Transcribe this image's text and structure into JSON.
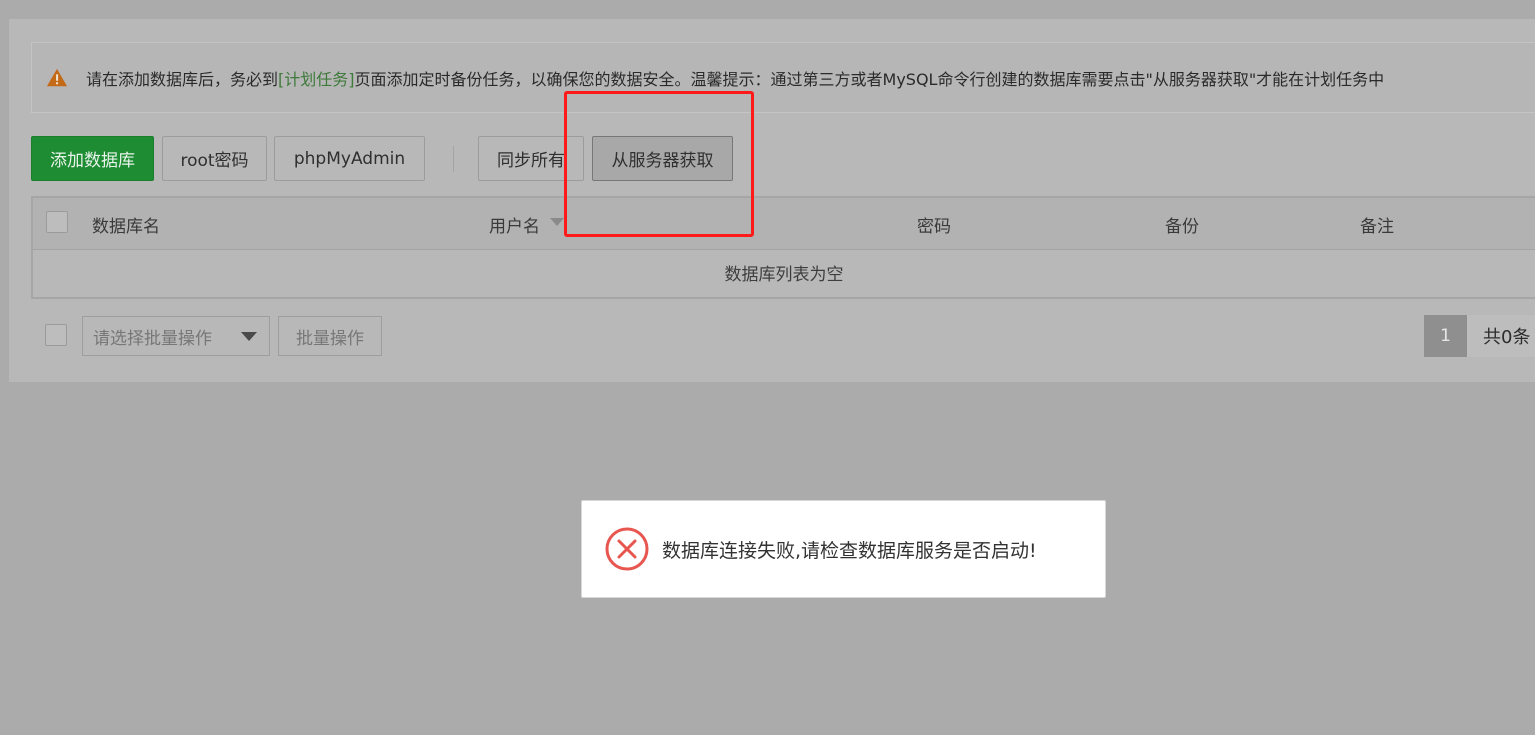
{
  "notice": {
    "text_before": "请在添加数据库后，务必到",
    "link": "[计划任务]",
    "text_after": "页面添加定时备份任务，以确保您的数据安全。温馨提示：通过第三方或者MySQL命令行创建的数据库需要点击\"从服务器获取\"才能在计划任务中"
  },
  "toolbar": {
    "add_db": "添加数据库",
    "root_pwd": "root密码",
    "phpmyadmin": "phpMyAdmin",
    "sync_all": "同步所有",
    "get_from_server": "从服务器获取"
  },
  "table": {
    "headers": [
      "数据库名",
      "用户名",
      "密码",
      "备份",
      "备注"
    ],
    "empty_text": "数据库列表为空"
  },
  "batch": {
    "placeholder": "请选择批量操作",
    "button": "批量操作"
  },
  "pagination": {
    "current_page": "1",
    "total": "共0条"
  },
  "toast": {
    "message": "数据库连接失败,请检查数据库服务是否启动!"
  },
  "colors": {
    "primary_green": "#1e8c33",
    "highlight_red": "#ff1a1a",
    "error_red": "#e8574f"
  }
}
